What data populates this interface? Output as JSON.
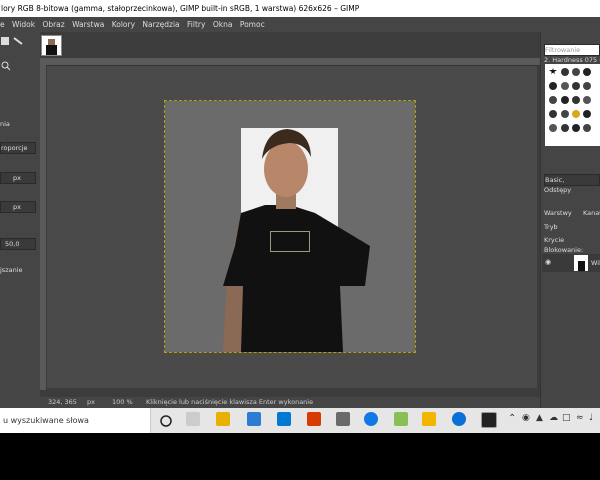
{
  "window": {
    "title": "lory RGB 8-bitowa (gamma, stałoprzecinkowa), GIMP built-in sRGB, 1 warstwa) 626x626 – GIMP"
  },
  "menu": [
    "e",
    "Widok",
    "Obraz",
    "Warstwa",
    "Kolory",
    "Narzędzia",
    "Filtry",
    "Okna",
    "Pomoc"
  ],
  "toolbox": {
    "labels": [
      "nia",
      "roporcje",
      "px",
      "px",
      "50,0",
      "jszanie"
    ]
  },
  "status": {
    "coords": "324, 365",
    "unit": "px",
    "zoom": "100 %",
    "message": "Kliknięcie lub naciśnięcie klawisza Enter wykonanie"
  },
  "right_panel": {
    "filter_placeholder": "Filtrowanie",
    "brush_name": "2. Hardness 075 (5",
    "preset": "Basic,",
    "spacing_label": "Odstępy",
    "tabs": [
      "Warstwy",
      "Kanał"
    ],
    "mode_label": "Tryb",
    "opacity_label": "Krycie",
    "lock_label": "Blokowanie:",
    "layer_name": "Wik"
  },
  "taskbar": {
    "search_placeholder": "u wyszukiwane słowa",
    "icon_colors": [
      "#ffffff",
      "#e8b000",
      "#2b7cd3",
      "#0078d4",
      "#d83b01",
      "#0f7ae5",
      "#88c057",
      "#f2b500",
      "#0a6fd6",
      "#222222"
    ]
  },
  "colors": {
    "ui_bg": "#454545",
    "canvas_bg": "#4a4a4a",
    "layer_bg": "#6b6b6b"
  }
}
